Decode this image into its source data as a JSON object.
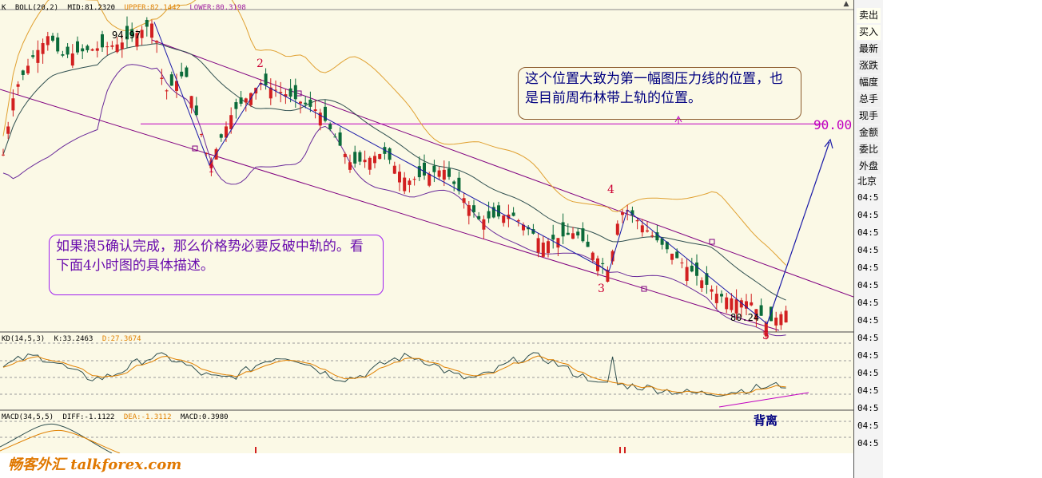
{
  "header": {
    "symbol": "K",
    "boll": "BOLL(20,2)",
    "mid": "MID:81.2320",
    "upper": "UPPER:82.1442",
    "lower": "LOWER:80.3198"
  },
  "kd_header": {
    "params": "KD(14,5,3)",
    "k": "K:33.2463",
    "d": "D:27.3674"
  },
  "macd_header": {
    "params": "MACD(34,5,5)",
    "diff": "DIFF:-1.1122",
    "dea": "DEA:-1.3112",
    "macd": "MACD:0.3980"
  },
  "annotations": {
    "top_note": "这个位置大致为第一幅图压力线的位置，也是目前周布林带上轨的位置。",
    "left_note": "如果浪5确认完成，那么价格势必要反破中轨的。看下面4小时图的具体描述。",
    "target": "90.00",
    "divergence": "背离",
    "high_label": "94.97",
    "low_label": "80.24",
    "waves": [
      "1",
      "2",
      "3",
      "4",
      "5"
    ]
  },
  "watermark": "畅客外汇 talkforex.com",
  "sidebar": {
    "buttons": [
      "卖出",
      "买入",
      "最新",
      "涨跌",
      "幅度",
      "总手",
      "现手",
      "金额",
      "委比",
      "外盘"
    ],
    "city": "北京",
    "times": [
      "04:5",
      "04:5",
      "04:5",
      "04:5",
      "04:5",
      "04:5",
      "04:5",
      "04:5",
      "04:5",
      "04:5",
      "04:5",
      "04:5",
      "04:5",
      "04:5",
      "04:5"
    ]
  },
  "colors": {
    "background": "#fbf9e6",
    "up": "#d22020",
    "down": "#0b6b3a",
    "upper_band": "#e0a030",
    "mid_band": "#2f4f4f",
    "lower_band": "#6a2a9a",
    "channel": "#800080",
    "wave_line": "#1a1aa8",
    "horizontal": "#c000c0"
  },
  "chart_data": {
    "type": "candlestick",
    "title": "",
    "indicators": [
      "BOLL(20,2)",
      "KD(14,5,3)",
      "MACD(34,5,5)"
    ],
    "bollinger_last": {
      "mid": 81.232,
      "upper": 82.1442,
      "lower": 80.3198
    },
    "price_range": [
      80,
      95.5
    ],
    "swing_points": [
      {
        "label": "94.97",
        "price": 94.97
      },
      {
        "label": "1",
        "price": 88.0
      },
      {
        "label": "2",
        "price": 92.0
      },
      {
        "label": "3",
        "price": 82.8
      },
      {
        "label": "4",
        "price": 85.8
      },
      {
        "label": "5",
        "price": 80.24
      }
    ],
    "resistance_level": 90.0,
    "kd_last": {
      "K": 33.2463,
      "D": 27.3674
    },
    "macd_last": {
      "DIFF": -1.1122,
      "DEA": -1.3112,
      "MACD": 0.398
    },
    "grid": true
  }
}
